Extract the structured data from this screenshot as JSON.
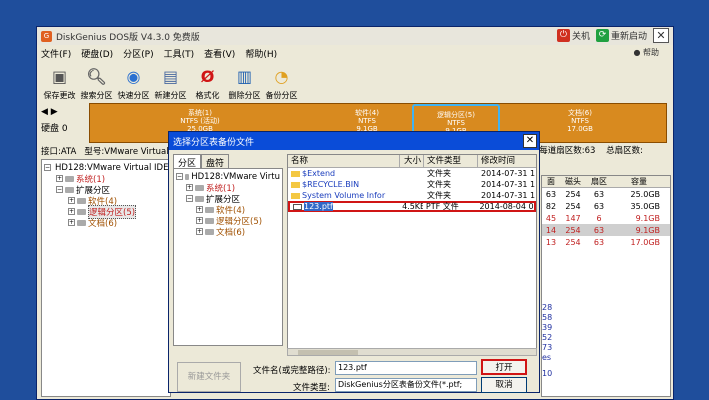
{
  "window": {
    "title": "DiskGenius DOS版 V4.3.0 免费版",
    "shutdown": "关机",
    "restart": "重新启动",
    "help": "● 帮助"
  },
  "menu": [
    "文件(F)",
    "硬盘(D)",
    "分区(P)",
    "工具(T)",
    "查看(V)",
    "帮助(H)"
  ],
  "toolbar": [
    "保存更改",
    "搜索分区",
    "快速分区",
    "新建分区",
    "格式化",
    "删除分区",
    "备份分区"
  ],
  "disk": {
    "label": "硬盘 0",
    "info": [
      "接口:ATA",
      "型号:VMware Virtual"
    ],
    "right_info": [
      "每道扇区数:63",
      "总扇区数:"
    ]
  },
  "partitions": [
    {
      "name": "系统(1)",
      "fs": "NTFS (活动)",
      "size": "25.0GB"
    },
    {
      "name": "软件(4)",
      "fs": "NTFS",
      "size": "9.1GB"
    },
    {
      "name": "逻辑分区(5)",
      "fs": "NTFS",
      "size": "9.1GB"
    },
    {
      "name": "文档(6)",
      "fs": "NTFS",
      "size": "17.0GB"
    }
  ],
  "left_tree": [
    {
      "text": "HD128:VMware Virtual IDE",
      "level": 0
    },
    {
      "text": "系统(1)",
      "level": 1
    },
    {
      "text": "扩展分区",
      "level": 1
    },
    {
      "text": "软件(4)",
      "level": 2
    },
    {
      "text": "逻辑分区(5)",
      "level": 2
    },
    {
      "text": "文档(6)",
      "level": 2
    }
  ],
  "right_table": {
    "headers": [
      "面",
      "磁头",
      "扇区",
      "容量"
    ],
    "rows": [
      [
        "63",
        "254",
        "63",
        "25.0GB"
      ],
      [
        "82",
        "254",
        "63",
        "35.0GB"
      ],
      [
        "45",
        "147",
        "6",
        "9.1GB"
      ],
      [
        "14",
        "254",
        "63",
        "9.1GB"
      ],
      [
        "13",
        "254",
        "63",
        "17.0GB"
      ]
    ],
    "nums": [
      "28",
      "58",
      "39",
      "52",
      "73",
      "es",
      "10"
    ]
  },
  "dialog": {
    "title": "选择分区表备份文件",
    "tabs": [
      "分区",
      "盘符"
    ],
    "tree": [
      {
        "text": "HD128:VMware Virtu",
        "level": 0
      },
      {
        "text": "系统(1)",
        "level": 1
      },
      {
        "text": "扩展分区",
        "level": 1
      },
      {
        "text": "软件(4)",
        "level": 2
      },
      {
        "text": "逻辑分区(5)",
        "level": 2
      },
      {
        "text": "文档(6)",
        "level": 2
      }
    ],
    "file_headers": [
      "名称",
      "大小",
      "文件类型",
      "修改时间"
    ],
    "files": [
      {
        "name": "$Extend",
        "size": "",
        "type": "文件夹",
        "date": "2014-07-31 1"
      },
      {
        "name": "$RECYCLE.BIN",
        "size": "",
        "type": "文件夹",
        "date": "2014-07-31 1"
      },
      {
        "name": "System Volume Infor",
        "size": "",
        "type": "文件夹",
        "date": "2014-07-31 1"
      },
      {
        "name": "123.ptf",
        "size": "4.5KB",
        "type": "PTF 文件",
        "date": "2014-08-04 09"
      }
    ],
    "new_folder": "新建文件夹",
    "filename_label": "文件名(或完整路径):",
    "filename_value": "123.ptf",
    "filetype_label": "文件类型:",
    "filetype_value": "DiskGenius分区表备份文件(*.ptf;",
    "open": "打开",
    "cancel": "取消"
  }
}
